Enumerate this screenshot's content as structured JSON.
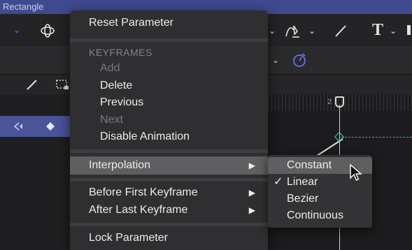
{
  "app": {
    "title": "Rectangle"
  },
  "timeline": {
    "ruler_label": "2"
  },
  "menu": {
    "reset": "Reset Parameter",
    "keyframes_header": "KEYFRAMES",
    "add": "Add",
    "delete": "Delete",
    "previous": "Previous",
    "next": "Next",
    "disable_animation": "Disable Animation",
    "interpolation": "Interpolation",
    "before_first": "Before First Keyframe",
    "after_last": "After Last Keyframe",
    "lock": "Lock Parameter"
  },
  "submenu": {
    "items": [
      {
        "label": "Constant",
        "checked": false
      },
      {
        "label": "Linear",
        "checked": true
      },
      {
        "label": "Bezier",
        "checked": false
      },
      {
        "label": "Continuous",
        "checked": false
      }
    ],
    "checkmark": "✓"
  },
  "glyphs": {
    "submenu_arrow": "▶",
    "dropdown": "⌄"
  },
  "colors": {
    "accent": "#3f4a8f",
    "highlight": "#5f5f61",
    "keyframe": "#2fd6c0"
  }
}
